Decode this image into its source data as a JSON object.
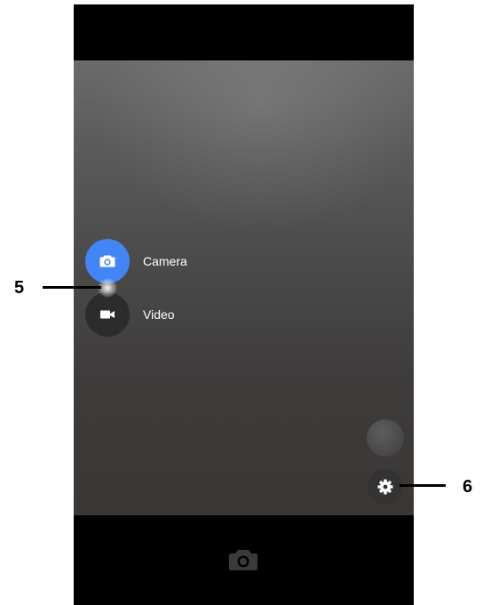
{
  "modes": {
    "camera_label": "Camera",
    "video_label": "Video",
    "selected": "Camera"
  },
  "icons": {
    "camera": "camera-icon",
    "video": "video-icon",
    "settings": "gear-icon",
    "shutter": "shutter-camera-icon"
  },
  "callouts": {
    "mode_switch": "5",
    "settings": "6"
  },
  "colors": {
    "accent": "#4285f4",
    "inactive": "#2c2c2c"
  }
}
